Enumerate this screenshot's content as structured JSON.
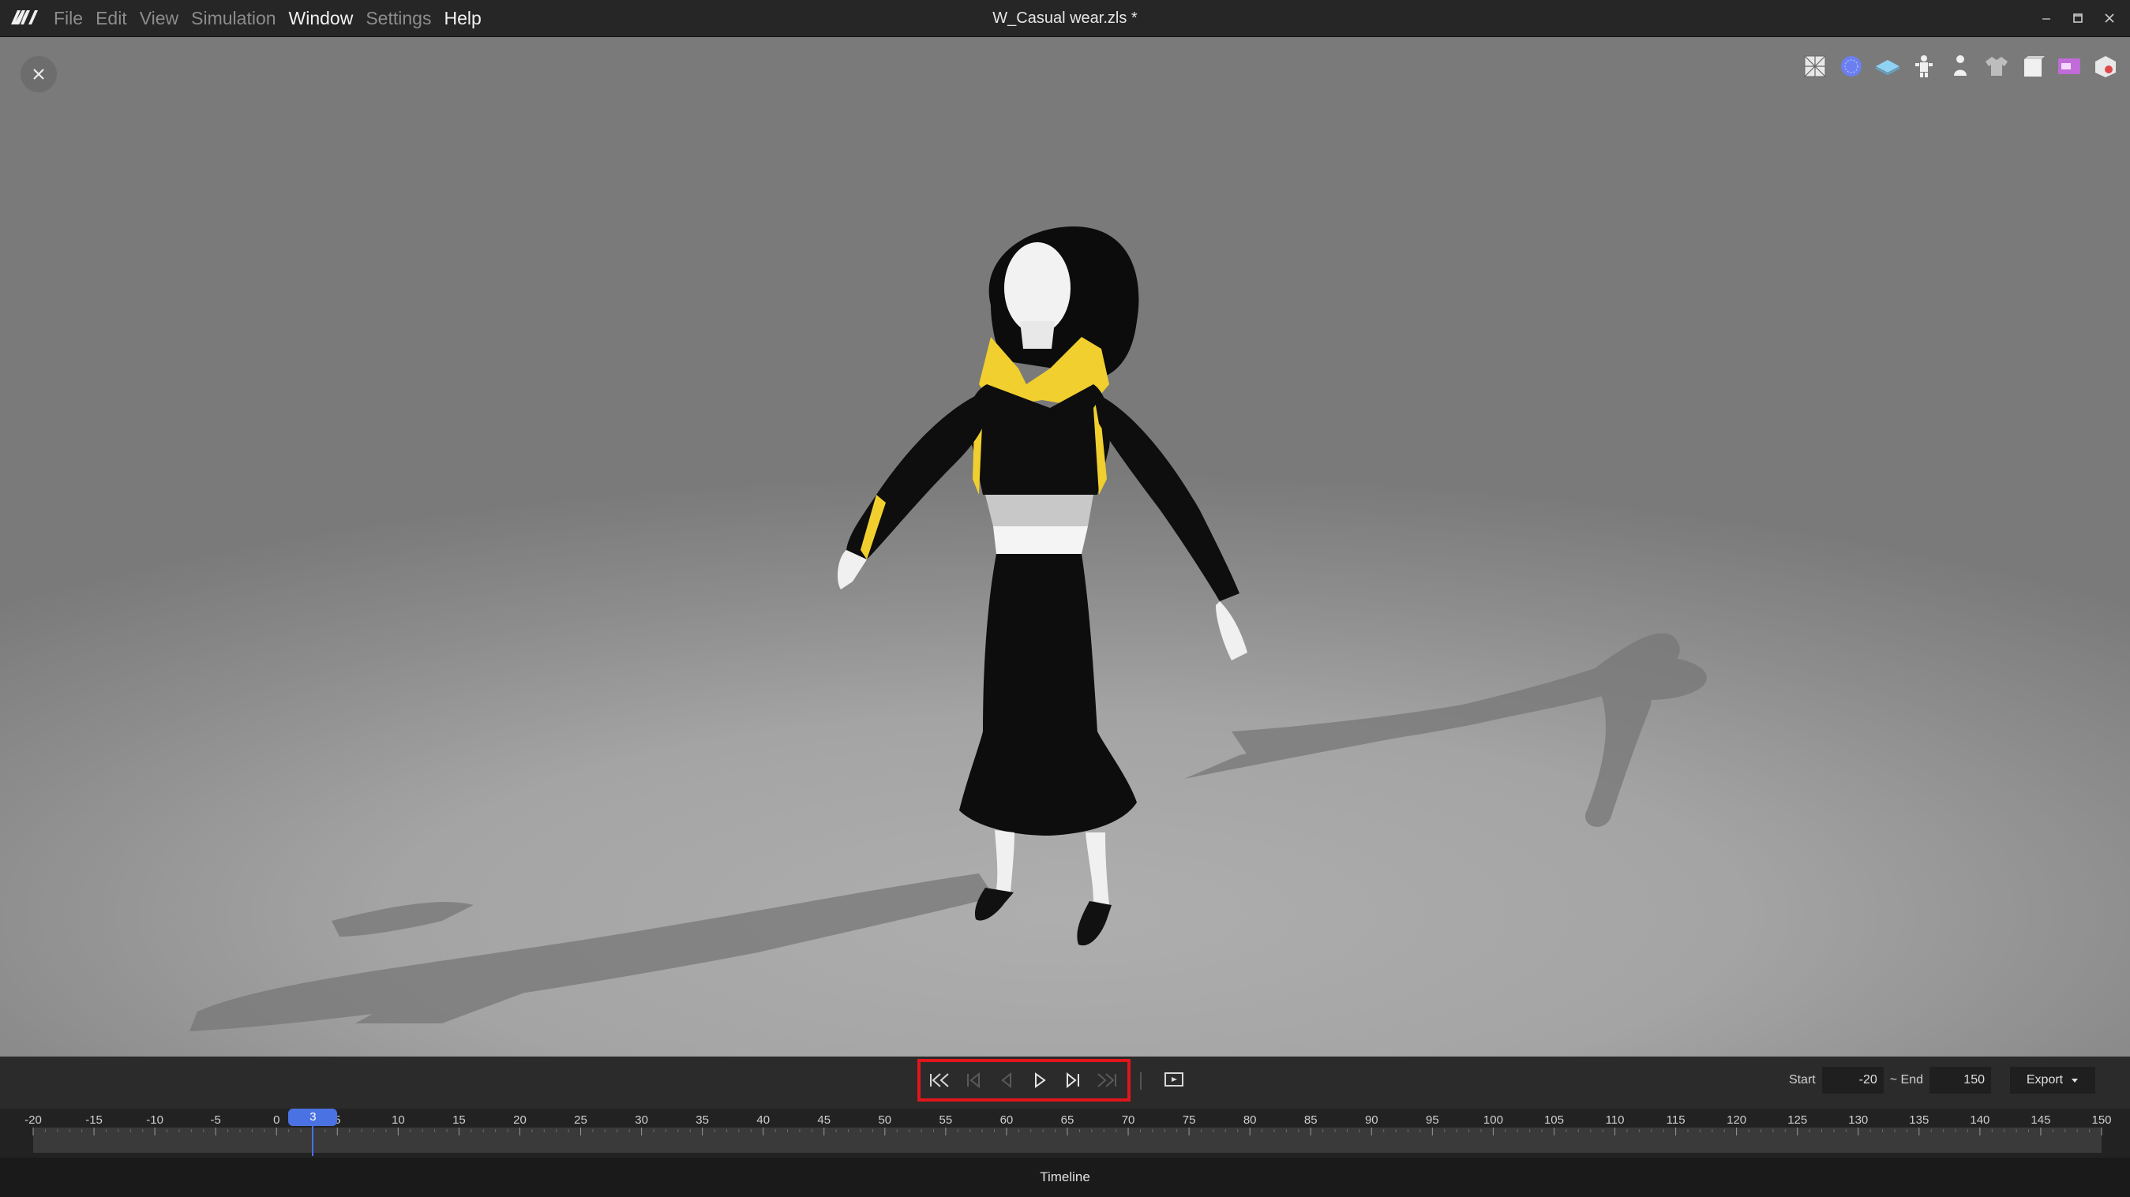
{
  "menubar": {
    "items": [
      {
        "label": "File",
        "bright": false
      },
      {
        "label": "Edit",
        "bright": false
      },
      {
        "label": "View",
        "bright": false
      },
      {
        "label": "Simulation",
        "bright": false
      },
      {
        "label": "Window",
        "bright": true
      },
      {
        "label": "Settings",
        "bright": false
      },
      {
        "label": "Help",
        "bright": true
      }
    ]
  },
  "window": {
    "title": "W_Casual wear.zls *"
  },
  "viewport": {
    "toolbar_icons": [
      "wireframe-mesh-icon",
      "particle-sphere-icon",
      "fabric-layer-icon",
      "avatar-joint-icon",
      "avatar-body-icon",
      "garment-icon",
      "solid-cube-icon",
      "sewing-machine-icon",
      "transparent-cube-icon"
    ]
  },
  "playback": {
    "buttons": [
      "skip-to-start",
      "previous-keyframe",
      "previous-frame",
      "play",
      "next-frame",
      "skip-to-end"
    ]
  },
  "range": {
    "start_label": "Start",
    "start_value": "-20",
    "end_label": "~ End",
    "end_value": "150",
    "export_label": "Export"
  },
  "timeline": {
    "ticks": [
      "-20",
      "-15",
      "-10",
      "-5",
      "0",
      "5",
      "10",
      "15",
      "20",
      "25",
      "30",
      "35",
      "40",
      "45",
      "50",
      "55",
      "60",
      "65",
      "70",
      "75",
      "80",
      "85",
      "90",
      "95",
      "100",
      "105",
      "110",
      "115",
      "120",
      "125",
      "130",
      "135",
      "140",
      "145",
      "150"
    ],
    "current_frame": "3"
  },
  "footer": {
    "panel_title": "Timeline"
  }
}
